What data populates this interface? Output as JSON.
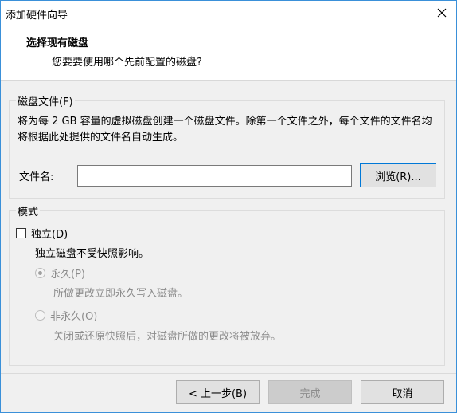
{
  "window": {
    "title": "添加硬件向导"
  },
  "header": {
    "title": "选择现有磁盘",
    "subtitle": "您要要使用哪个先前配置的磁盘?"
  },
  "disk_file": {
    "group_label": "磁盘文件(F)",
    "description": "将为每 2 GB 容量的虚拟磁盘创建一个磁盘文件。除第一个文件之外，每个文件的文件名均将根据此处提供的文件名自动生成。",
    "filename_label": "文件名:",
    "filename_value": "",
    "browse_label": "浏览(R)..."
  },
  "mode": {
    "group_label": "模式",
    "independent_label": "独立(D)",
    "independent_checked": false,
    "independent_desc": "独立磁盘不受快照影响。",
    "persistent_label": "永久(P)",
    "persistent_checked": true,
    "persistent_desc": "所做更改立即永久写入磁盘。",
    "nonpersistent_label": "非永久(O)",
    "nonpersistent_checked": false,
    "nonpersistent_desc": "关闭或还原快照后，对磁盘所做的更改将被放弃。"
  },
  "footer": {
    "back_label": "< 上一步(B)",
    "finish_label": "完成",
    "cancel_label": "取消"
  }
}
